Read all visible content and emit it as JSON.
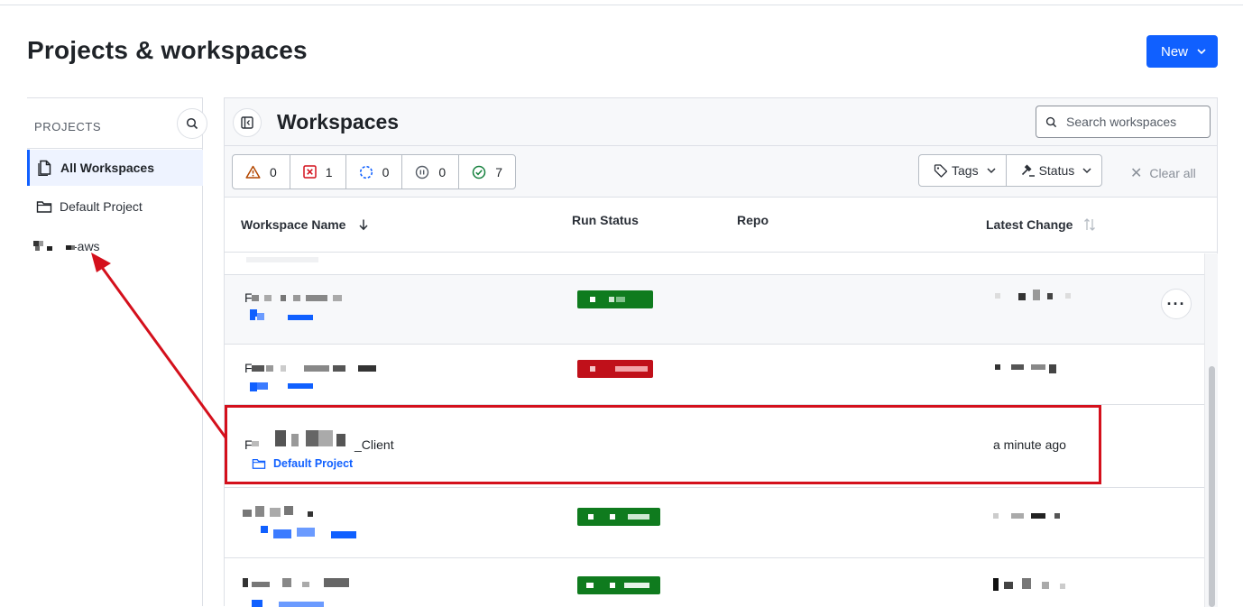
{
  "header": {
    "title": "Projects & workspaces",
    "new_button": "New"
  },
  "sidebar": {
    "heading": "PROJECTS",
    "items": [
      {
        "label": "All Workspaces",
        "active": true
      },
      {
        "label": "Default Project",
        "active": false
      },
      {
        "label": "-aws",
        "active": false
      }
    ]
  },
  "main": {
    "title": "Workspaces",
    "search_placeholder": "Search workspaces",
    "status_counts": [
      {
        "icon": "warning-icon",
        "count": "0",
        "color": "#b34700"
      },
      {
        "icon": "error-icon",
        "count": "1",
        "color": "#d4101c"
      },
      {
        "icon": "running-icon",
        "count": "0",
        "color": "#1060ff"
      },
      {
        "icon": "paused-icon",
        "count": "0",
        "color": "#555c66"
      },
      {
        "icon": "success-icon",
        "count": "7",
        "color": "#15803d"
      }
    ],
    "filters": {
      "tags": "Tags",
      "status": "Status",
      "clear": "Clear all"
    },
    "columns": {
      "name": "Workspace Name",
      "run_status": "Run Status",
      "repo": "Repo",
      "latest_change": "Latest Change"
    },
    "rows": [
      {
        "name": "F",
        "status": "success",
        "status_color": "#0f7b1e"
      },
      {
        "name": "F",
        "status": "error",
        "status_color": "#c0101a"
      },
      {
        "name_suffix": "_Client",
        "project": "Default Project",
        "latest_change": "a minute ago"
      },
      {
        "status": "success",
        "status_color": "#0f7b1e"
      },
      {
        "status": "success",
        "status_color": "#0f7b1e"
      }
    ]
  },
  "colors": {
    "accent": "#1060ff",
    "annotation": "#d4101c"
  }
}
